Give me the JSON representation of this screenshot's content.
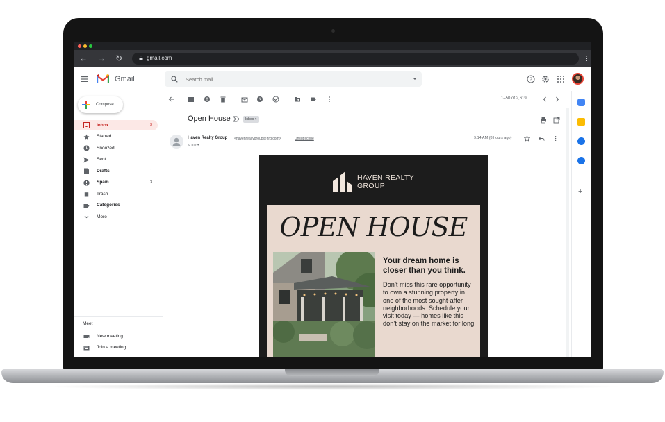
{
  "browser": {
    "url": "gmail.com"
  },
  "app": {
    "name": "Gmail"
  },
  "search": {
    "placeholder": "Search mail"
  },
  "compose": {
    "label": "Compose"
  },
  "nav": [
    {
      "label": "Inbox",
      "count": "3",
      "active": true,
      "bold": true,
      "icon": "inbox-icon"
    },
    {
      "label": "Starred",
      "count": "",
      "active": false,
      "bold": false,
      "icon": "star-icon"
    },
    {
      "label": "Snoozed",
      "count": "",
      "active": false,
      "bold": false,
      "icon": "clock-icon"
    },
    {
      "label": "Sent",
      "count": "",
      "active": false,
      "bold": false,
      "icon": "send-icon"
    },
    {
      "label": "Drafts",
      "count": "1",
      "active": false,
      "bold": true,
      "icon": "draft-icon"
    },
    {
      "label": "Spam",
      "count": "3",
      "active": false,
      "bold": true,
      "icon": "spam-icon"
    },
    {
      "label": "Trash",
      "count": "",
      "active": false,
      "bold": false,
      "icon": "trash-icon"
    },
    {
      "label": "Categories",
      "count": "",
      "active": false,
      "bold": true,
      "icon": "label-icon"
    },
    {
      "label": "More",
      "count": "",
      "active": false,
      "bold": false,
      "icon": "chevron-down-icon"
    }
  ],
  "meet": {
    "title": "Meet",
    "items": [
      {
        "label": "New meeting",
        "icon": "video-icon"
      },
      {
        "label": "Join a meeting",
        "icon": "keyboard-icon"
      }
    ]
  },
  "toolbar": {
    "range": "1–50 of 2,619"
  },
  "message": {
    "subject": "Open House",
    "label": "Inbox",
    "sender_name": "Haven Realty Group",
    "sender_email": "<havenrealtygroup@hrg.com>",
    "unsubscribe": "Unsubscribe",
    "to": "to me",
    "time": "9:14 AM (8 hours ago)"
  },
  "email": {
    "brand_line1": "HAVEN REALTY",
    "brand_line2": "GROUP",
    "headline": "OPEN HOUSE",
    "promo_title": "Your dream home is closer than you think.",
    "promo_body": "Don’t miss this rare opportunity to own a stunning property in one of the most sought-after neighborhoods. Schedule your visit today — homes like this don’t stay on the market for long.",
    "colors": {
      "dark": "#1c1c1c",
      "card": "#e9d9cf",
      "brand_text": "#f1e6dd"
    }
  },
  "colors": {
    "gmail_red": "#ea4335",
    "active_nav": "#fce8e6"
  }
}
